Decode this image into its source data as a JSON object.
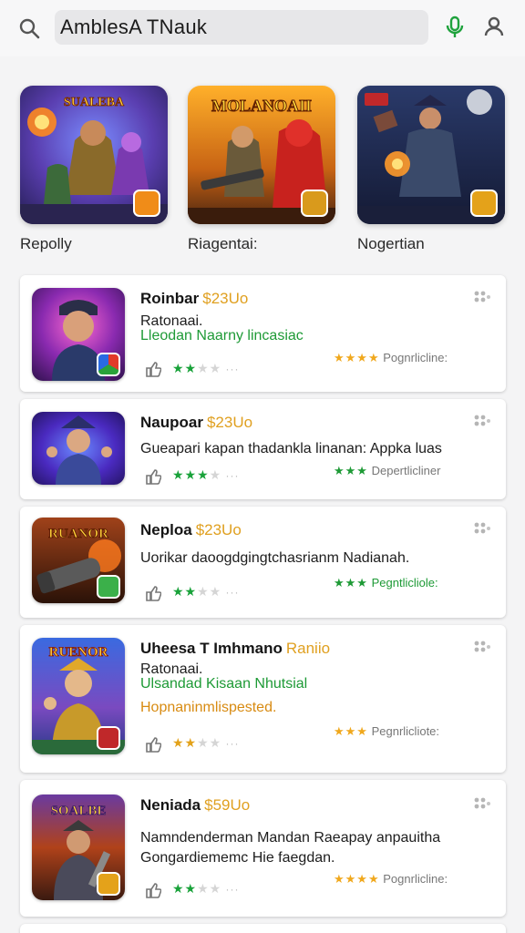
{
  "search": {
    "value": "AmblesA TNauk"
  },
  "featured": [
    {
      "art": "SUALEBA",
      "label": "Repolly",
      "badge_color": "#f08c18"
    },
    {
      "art": "MOLANOAII",
      "label": "Riagentai:",
      "badge_color": "#d99a1c"
    },
    {
      "art": "",
      "label": "Nogertian",
      "badge_color": "#e4a21a"
    }
  ],
  "list": [
    {
      "title": "Roinbar",
      "price": "$23Uo",
      "lines": [
        "Ratonaai.",
        "Lleodan Naarny lincasiac"
      ],
      "stars_left": {
        "filled": 2,
        "empty": 2
      },
      "rating_text": "Pognrlicline:",
      "rating_stars": "★★★★"
    },
    {
      "title": "Naupoar",
      "price": "$23Uo",
      "lines": [
        "Gueapari kapan thadankla linanan: Appka luas"
      ],
      "stars_left": {
        "filled": 3,
        "empty": 1
      },
      "rating_text": "Depertlicliner",
      "rating_stars": "★★★"
    },
    {
      "title": "Neploa",
      "price": "$23Uo",
      "lines": [
        "Uorikar daoogdgingtchasrianm Nadianah."
      ],
      "stars_left": {
        "filled": 2,
        "empty": 2
      },
      "rating_text": "Pegntlicliole:",
      "rating_stars": "★★★"
    },
    {
      "title": "Uheesa T Imhmano",
      "price": "Raniio",
      "art": "RUENOR",
      "lines": [
        "Ratonaai.",
        "Ulsandad Kisaan Nhutsial",
        "Hopnaninmlispested."
      ],
      "stars_left": {
        "filled": 2,
        "empty": 2
      },
      "rating_text": "Pegnrlicliote:",
      "rating_stars": "★★★"
    },
    {
      "title": "Neniada",
      "price": "$59Uo",
      "art": "SOALBE",
      "lines": [
        "Namndenderman Mandan Raeapay anpauitha",
        "Gongardiememc Hie faegdan."
      ],
      "stars_left": {
        "filled": 2,
        "empty": 2
      },
      "rating_text": "Pognrlicline:",
      "rating_stars": "★★★★"
    }
  ],
  "colors": {
    "accent_green": "#1e9a36",
    "price_orange": "#e0a020",
    "star_orange": "#f0a81d"
  },
  "icons": [
    "search-icon",
    "mic-icon",
    "user-icon",
    "dots-icon",
    "thumb-icon",
    "star-icon"
  ]
}
